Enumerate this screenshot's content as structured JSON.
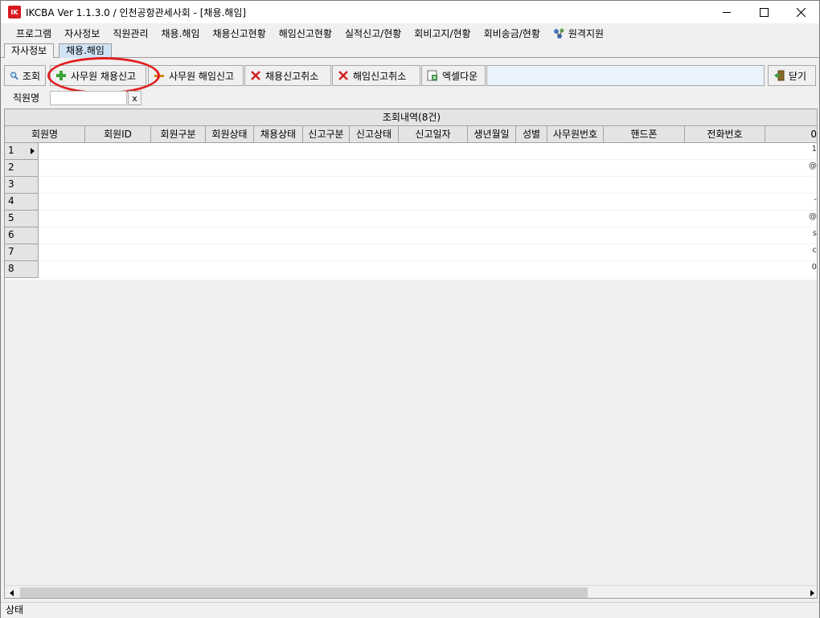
{
  "window": {
    "title": "IKCBA Ver 1.1.3.0 / 인천공항관세사회 - [채용.해임]",
    "app_icon_text": "IK",
    "minimize_icon": "minimize-icon",
    "maximize_icon": "maximize-icon",
    "close_icon": "close-icon"
  },
  "menu": [
    {
      "label": "프로그램"
    },
    {
      "label": "자사정보"
    },
    {
      "label": "직원관리"
    },
    {
      "label": "채용.해임"
    },
    {
      "label": "채용신고현황"
    },
    {
      "label": "해임신고현황"
    },
    {
      "label": "실적신고/현황"
    },
    {
      "label": "회비고지/현황"
    },
    {
      "label": "회비송금/현황"
    },
    {
      "label": "원격지원",
      "icon": "remote-support-icon"
    }
  ],
  "tabs": [
    {
      "label": "자사정보",
      "active": false
    },
    {
      "label": "채용.해임",
      "active": true
    }
  ],
  "toolbar": {
    "search_label": "조회",
    "hire_label": "사무원 채용신고",
    "dismiss_label": "사무원 해임신고",
    "hire_cancel_label": "채용신고취소",
    "dismiss_cancel_label": "해임신고취소",
    "excel_label": "엑셀다운",
    "close_label": "닫기"
  },
  "search": {
    "label": "직원명",
    "value": "",
    "clear": "x"
  },
  "grid": {
    "caption": "조회내역(8건)",
    "columns": [
      "회원명",
      "회원ID",
      "회원구분",
      "회원상태",
      "채용상태",
      "신고구분",
      "신고상태",
      "신고일자",
      "생년월일",
      "성별",
      "사무원번호",
      "핸드폰",
      "전화번호",
      "0"
    ],
    "rows": [
      {
        "num": "1",
        "cut": "1"
      },
      {
        "num": "2",
        "cut": "@"
      },
      {
        "num": "3",
        "cut": ""
      },
      {
        "num": "4",
        "cut": "-"
      },
      {
        "num": "5",
        "cut": "@"
      },
      {
        "num": "6",
        "cut": "s"
      },
      {
        "num": "7",
        "cut": "c"
      },
      {
        "num": "8",
        "cut": "0"
      }
    ]
  },
  "status": {
    "label": "상태"
  },
  "colors": {
    "highlight": "#e02020",
    "active_tab": "#cfe3f5",
    "title_icon": "#d7191f"
  }
}
